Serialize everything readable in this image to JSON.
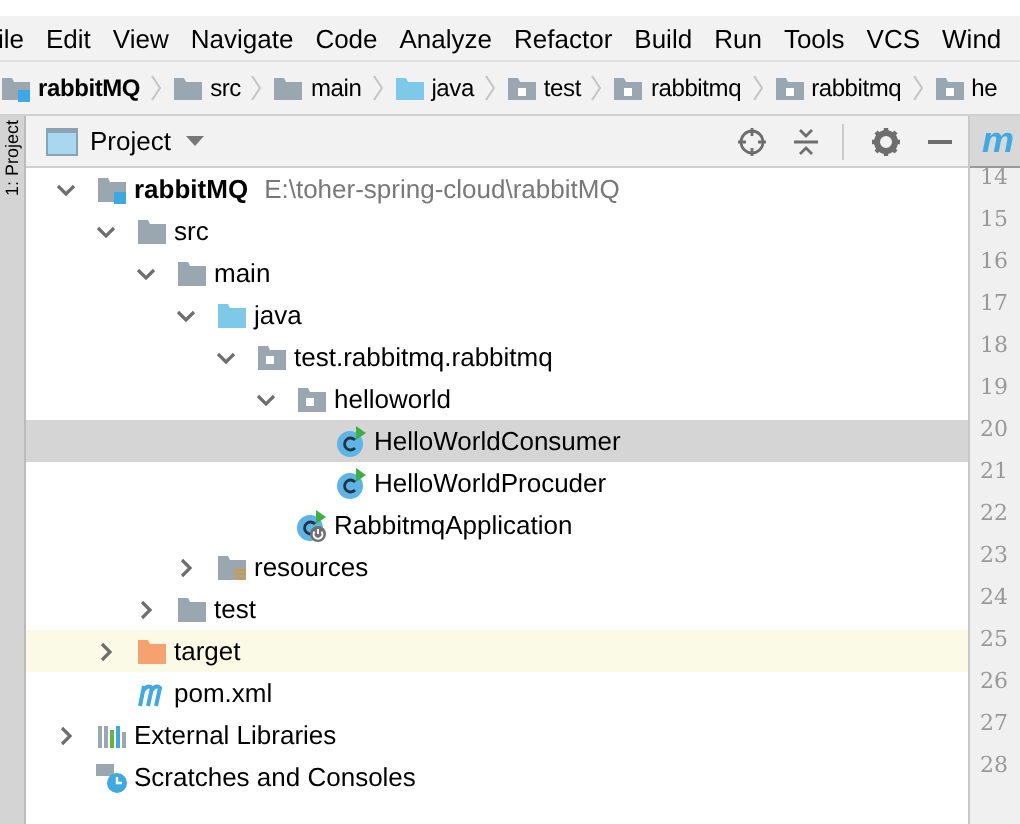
{
  "menu_bar": [
    "ile",
    "Edit",
    "View",
    "Navigate",
    "Code",
    "Analyze",
    "Refactor",
    "Build",
    "Run",
    "Tools",
    "VCS",
    "Wind"
  ],
  "breadcrumbs": [
    {
      "label": "rabbitMQ",
      "kind": "module"
    },
    {
      "label": "src",
      "kind": "folder"
    },
    {
      "label": "main",
      "kind": "folder"
    },
    {
      "label": "java",
      "kind": "source"
    },
    {
      "label": "test",
      "kind": "package"
    },
    {
      "label": "rabbitmq",
      "kind": "package"
    },
    {
      "label": "rabbitmq",
      "kind": "package"
    },
    {
      "label": "he",
      "kind": "package"
    }
  ],
  "side_tab": "1: Project",
  "project": {
    "title": "Project",
    "tree": [
      {
        "label": "rabbitMQ",
        "path": "E:\\toher-spring-cloud\\rabbitMQ",
        "kind": "module",
        "expanded": true,
        "selected": false,
        "children": [
          {
            "label": "src",
            "kind": "folder",
            "expanded": true,
            "selected": false,
            "children": [
              {
                "label": "main",
                "kind": "folder",
                "expanded": true,
                "selected": false,
                "children": [
                  {
                    "label": "java",
                    "kind": "source",
                    "expanded": true,
                    "selected": false,
                    "children": [
                      {
                        "label": "test.rabbitmq.rabbitmq",
                        "kind": "package",
                        "expanded": true,
                        "selected": false,
                        "children": [
                          {
                            "label": "helloworld",
                            "kind": "package",
                            "expanded": true,
                            "selected": false,
                            "children": [
                              {
                                "label": "HelloWorldConsumer",
                                "kind": "class",
                                "selected": true
                              },
                              {
                                "label": "HelloWorldProcuder",
                                "kind": "class",
                                "selected": false
                              }
                            ]
                          },
                          {
                            "label": "RabbitmqApplication",
                            "kind": "spring",
                            "selected": false
                          }
                        ]
                      }
                    ]
                  },
                  {
                    "label": "resources",
                    "kind": "resources",
                    "expanded": false,
                    "selected": false
                  }
                ]
              },
              {
                "label": "test",
                "kind": "folder",
                "expanded": false,
                "selected": false
              }
            ]
          },
          {
            "label": "target",
            "kind": "excluded",
            "expanded": false,
            "selected": false
          },
          {
            "label": "pom.xml",
            "kind": "maven",
            "selected": false
          }
        ]
      },
      {
        "label": "External Libraries",
        "kind": "libraries",
        "expanded": false,
        "selected": false
      },
      {
        "label": "Scratches and Consoles",
        "kind": "scratches",
        "selected": false
      }
    ]
  },
  "editor_tab": "m",
  "line_numbers": [
    "14",
    "15",
    "16",
    "17",
    "18",
    "19",
    "20",
    "21",
    "22",
    "23",
    "24",
    "25",
    "26",
    "27",
    "28"
  ]
}
